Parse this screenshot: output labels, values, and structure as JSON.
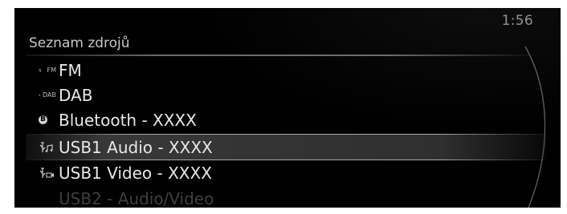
{
  "clock": "1:56",
  "title": "Seznam zdrojů",
  "sources": [
    {
      "label": "FM",
      "icon": "radio-fm-icon",
      "icon_text": "FM",
      "state": "normal"
    },
    {
      "label": "DAB",
      "icon": "radio-dab-icon",
      "icon_text": "DAB",
      "state": "normal"
    },
    {
      "label": "Bluetooth - XXXX",
      "icon": "bluetooth-icon",
      "icon_text": "B",
      "state": "normal"
    },
    {
      "label": "USB1 Audio - XXXX",
      "icon": "usb-audio-icon",
      "icon_text": "",
      "state": "selected"
    },
    {
      "label": "USB1 Video - XXXX",
      "icon": "usb-video-icon",
      "icon_text": "",
      "state": "normal"
    },
    {
      "label": "USB2 - Audio/Video",
      "icon": "usb-icon",
      "icon_text": "",
      "state": "disabled"
    }
  ],
  "colors": {
    "background": "#000000",
    "text": "#e8e8e8",
    "selected_bar": "#333333",
    "disabled_text": "#3f3f3f"
  }
}
